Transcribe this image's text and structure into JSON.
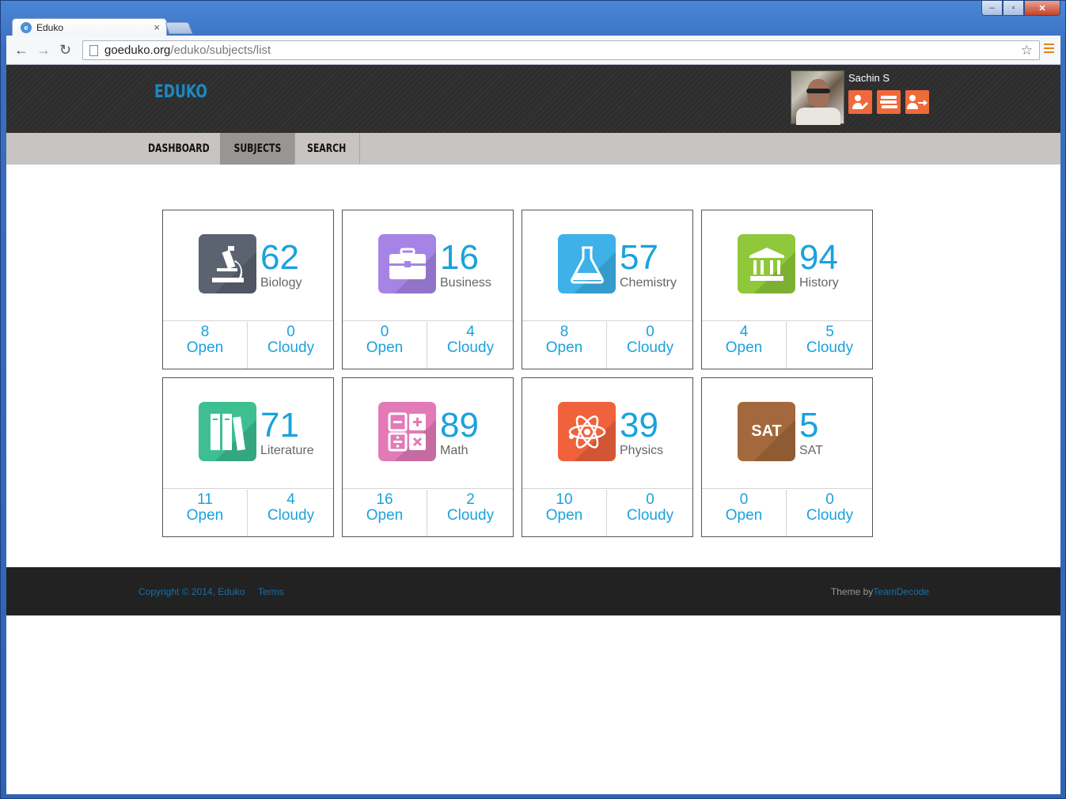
{
  "browser": {
    "tab_title": "Eduko",
    "url_host": "goeduko.org",
    "url_path": "/eduko/subjects/list",
    "window_controls": {
      "minimize": "‒",
      "maximize": "▫",
      "close": "✕"
    },
    "nav_icons": {
      "back": "←",
      "forward": "→",
      "reload": "↻",
      "star": "☆"
    }
  },
  "header": {
    "brand": "EDUKO",
    "user_name": "Sachin  S",
    "action_icons": [
      "profile-edit-icon",
      "books-icon",
      "logout-icon"
    ]
  },
  "nav": {
    "items": [
      {
        "label": "DASHBOARD",
        "active": false
      },
      {
        "label": "SUBJECTS",
        "active": true
      },
      {
        "label": "SEARCH",
        "active": false
      }
    ]
  },
  "subjects": [
    {
      "name": "Biology",
      "count": "62",
      "open": "8",
      "cloudy": "0",
      "color": "#5c6370",
      "icon": "microscope-icon"
    },
    {
      "name": "Business",
      "count": "16",
      "open": "0",
      "cloudy": "4",
      "color": "#a684e6",
      "icon": "briefcase-icon"
    },
    {
      "name": "Chemistry",
      "count": "57",
      "open": "8",
      "cloudy": "0",
      "color": "#3db1e8",
      "icon": "flask-icon"
    },
    {
      "name": "History",
      "count": "94",
      "open": "4",
      "cloudy": "5",
      "color": "#8fc83a",
      "icon": "museum-icon"
    },
    {
      "name": "Literature",
      "count": "71",
      "open": "11",
      "cloudy": "4",
      "color": "#3dbf92",
      "icon": "books-shelf-icon"
    },
    {
      "name": "Math",
      "count": "89",
      "open": "16",
      "cloudy": "2",
      "color": "#e27ab8",
      "icon": "calculator-icon"
    },
    {
      "name": "Physics",
      "count": "39",
      "open": "10",
      "cloudy": "0",
      "color": "#f0623c",
      "icon": "atom-icon"
    },
    {
      "name": "SAT",
      "count": "5",
      "open": "0",
      "cloudy": "0",
      "color": "#a3683b",
      "icon": "sat-icon",
      "icon_text": "SAT"
    }
  ],
  "labels": {
    "open": "Open",
    "cloudy": "Cloudy"
  },
  "footer": {
    "copyright": "Copyright © 2014, Eduko",
    "terms": "Terms",
    "theme_prefix": "Theme by",
    "theme_link": "TeamDecode"
  }
}
